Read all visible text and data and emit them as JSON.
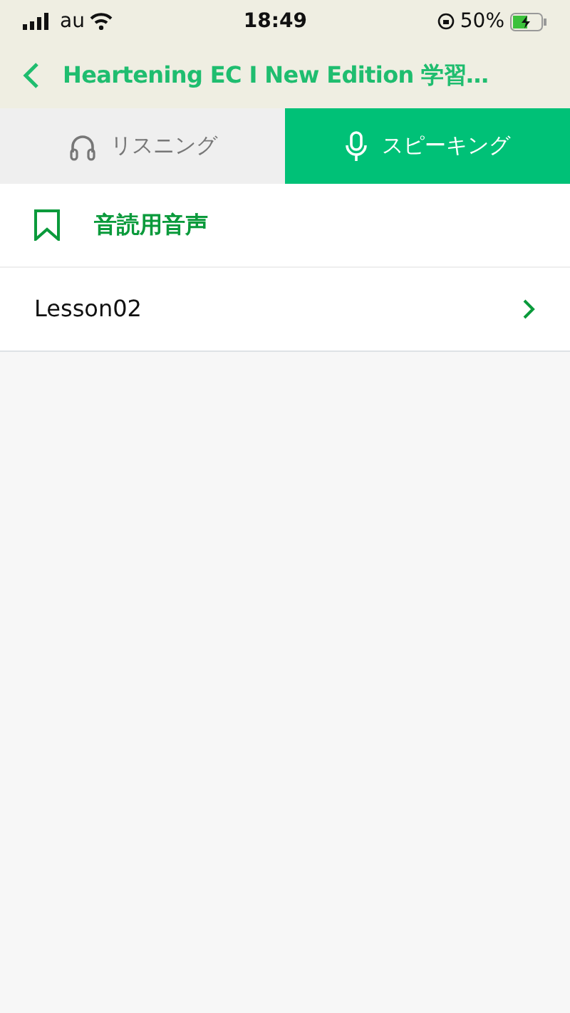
{
  "status_bar": {
    "carrier": "au",
    "time": "18:49",
    "battery": "50%"
  },
  "header": {
    "title": "Heartening EC I New Edition 学習…"
  },
  "tabs": [
    {
      "label": "リスニング",
      "kind": "headphones",
      "selected": false
    },
    {
      "label": "スピーキング",
      "kind": "microphone",
      "selected": true
    }
  ],
  "section": {
    "title": "音読用音声"
  },
  "items": [
    {
      "label": "Lesson02"
    }
  ]
}
